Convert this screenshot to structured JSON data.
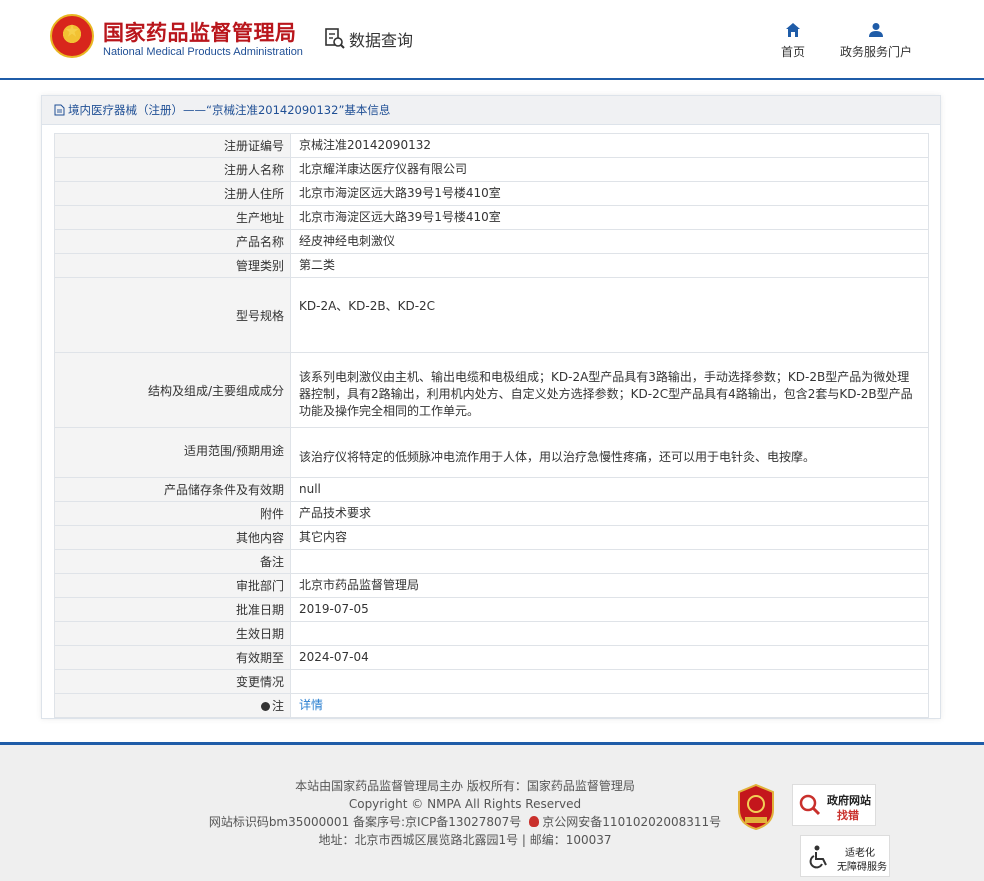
{
  "header": {
    "title_cn": "国家药品监督管理局",
    "title_en": "National Medical Products Administration",
    "data_query_label": "数据查询",
    "nav": [
      {
        "label": "首页",
        "icon": "home-icon"
      },
      {
        "label": "政务服务门户",
        "icon": "user-icon"
      }
    ]
  },
  "panel": {
    "heading": "境内医疗器械（注册）——“京械注准20142090132”基本信息",
    "rows": [
      {
        "label": "注册证编号",
        "value": "京械注准20142090132"
      },
      {
        "label": "注册人名称",
        "value": "北京耀洋康达医疗仪器有限公司"
      },
      {
        "label": "注册人住所",
        "value": "北京市海淀区远大路39号1号楼410室"
      },
      {
        "label": "生产地址",
        "value": "北京市海淀区远大路39号1号楼410室"
      },
      {
        "label": "产品名称",
        "value": "经皮神经电刺激仪"
      },
      {
        "label": "管理类别",
        "value": "第二类"
      },
      {
        "label": "型号规格",
        "value": "KD-2A、KD-2B、KD-2C"
      },
      {
        "label": "结构及组成/主要组成成分",
        "value": "该系列电刺激仪由主机、输出电缆和电极组成；KD-2A型产品具有3路输出，手动选择参数；KD-2B型产品为微处理器控制，具有2路输出，利用机内处方、自定义处方选择参数；KD-2C型产品具有4路输出，包含2套与KD-2B型产品功能及操作完全相同的工作单元。"
      },
      {
        "label": "适用范围/预期用途",
        "value": "该治疗仪将特定的低频脉冲电流作用于人体，用以治疗急慢性疼痛，还可以用于电针灸、电按摩。"
      },
      {
        "label": "产品储存条件及有效期",
        "value": "null"
      },
      {
        "label": "附件",
        "value": "产品技术要求"
      },
      {
        "label": "其他内容",
        "value": "其它内容"
      },
      {
        "label": "备注",
        "value": ""
      },
      {
        "label": "审批部门",
        "value": "北京市药品监督管理局"
      },
      {
        "label": "批准日期",
        "value": "2019-07-05"
      },
      {
        "label": "生效日期",
        "value": ""
      },
      {
        "label": "有效期至",
        "value": "2024-07-04"
      },
      {
        "label": "变更情况",
        "value": ""
      }
    ],
    "note_label": "注",
    "note_link": "详情"
  },
  "footer": {
    "line1": "本站由国家药品监督管理局主办 版权所有：国家药品监督管理局",
    "line2": "Copyright © NMPA All Rights Reserved",
    "line3_a": "网站标识码bm35000001   备案序号:京ICP备13027807号",
    "line3_b": "京公网安备11010202008311号",
    "line4": "地址：北京市西城区展览路北露园1号 | 邮编：100037",
    "gov_badge_t1": "政府网站",
    "gov_badge_t2": "找错",
    "access_t1": "适老化",
    "access_t2": "无障碍服务"
  },
  "colors": {
    "brand_red": "#b9161c",
    "brand_blue": "#1f5ca8",
    "link_blue": "#2a7fd0"
  }
}
